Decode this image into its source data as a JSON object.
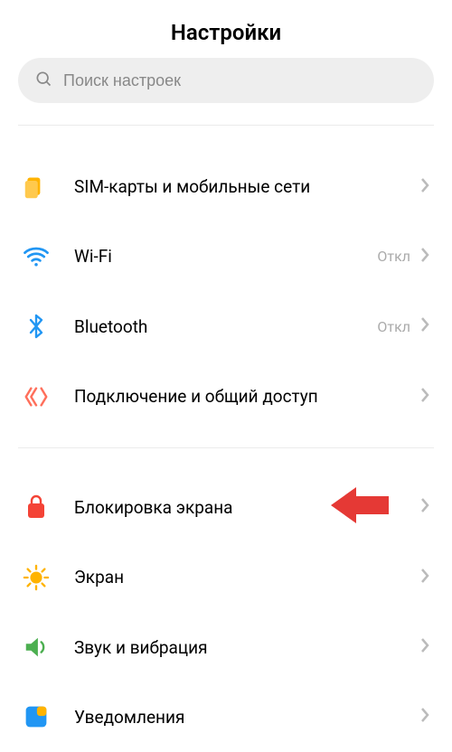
{
  "title": "Настройки",
  "search": {
    "placeholder": "Поиск настроек"
  },
  "rows": {
    "sim": {
      "label": "SIM-карты и мобильные сети",
      "status": ""
    },
    "wifi": {
      "label": "Wi-Fi",
      "status": "Откл"
    },
    "bluetooth": {
      "label": "Bluetooth",
      "status": "Откл"
    },
    "tether": {
      "label": "Подключение и общий доступ",
      "status": ""
    },
    "lockscreen": {
      "label": "Блокировка экрана",
      "status": ""
    },
    "display": {
      "label": "Экран",
      "status": ""
    },
    "sound": {
      "label": "Звук и вибрация",
      "status": ""
    },
    "notifications": {
      "label": "Уведомления",
      "status": ""
    }
  },
  "colors": {
    "sim": "#FFB300",
    "wifi": "#2196F3",
    "bluetooth": "#2196F3",
    "tether": "#FF6F5B",
    "lockscreen": "#F44336",
    "display": "#FFB300",
    "sound": "#4CAF50",
    "notifications": "#2196F3",
    "arrow": "#E53935",
    "chevron": "#bbbbbb"
  }
}
